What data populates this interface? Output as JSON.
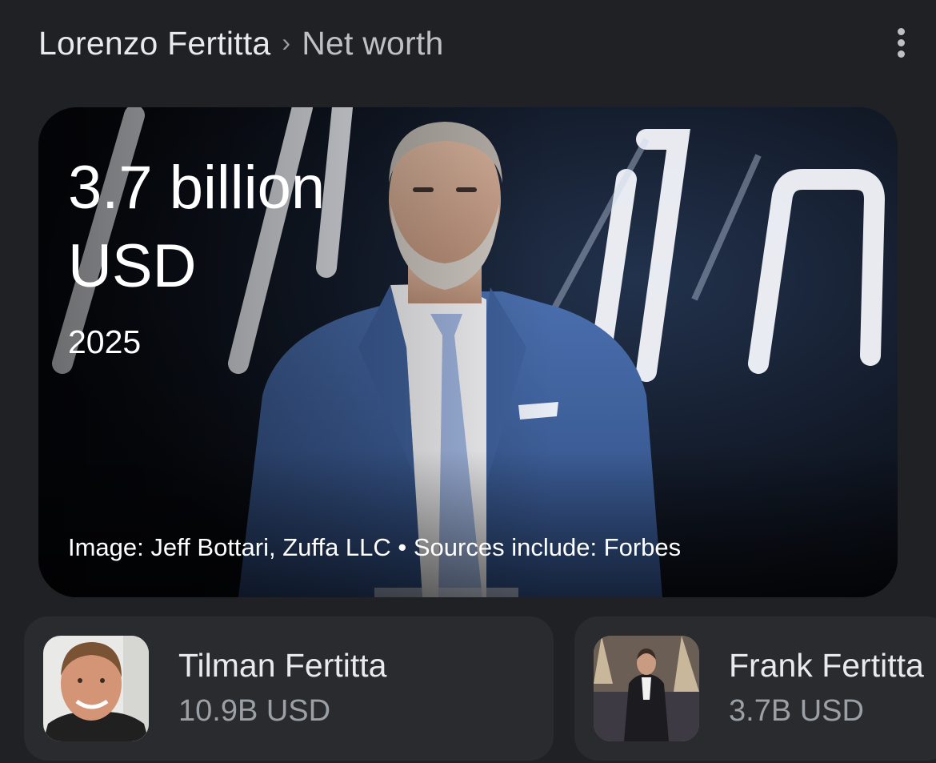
{
  "breadcrumb": {
    "root": "Lorenzo Fertitta",
    "separator": "›",
    "current": "Net worth"
  },
  "more_menu": {
    "icon": "more-vert-icon"
  },
  "hero": {
    "value_line1": "3.7 billion",
    "value_line2": "USD",
    "year": "2025",
    "credit": "Image: Jeff Bottari, Zuffa LLC • Sources include: Forbes"
  },
  "related": [
    {
      "name": "Tilman Fertitta",
      "value": "10.9B USD"
    },
    {
      "name": "Frank Fertitta",
      "value": "3.7B USD"
    }
  ],
  "colors": {
    "background": "#202124",
    "card": "#2a2b2e",
    "suit": "#3b5f9a",
    "muted_text": "#9aa0a6"
  }
}
